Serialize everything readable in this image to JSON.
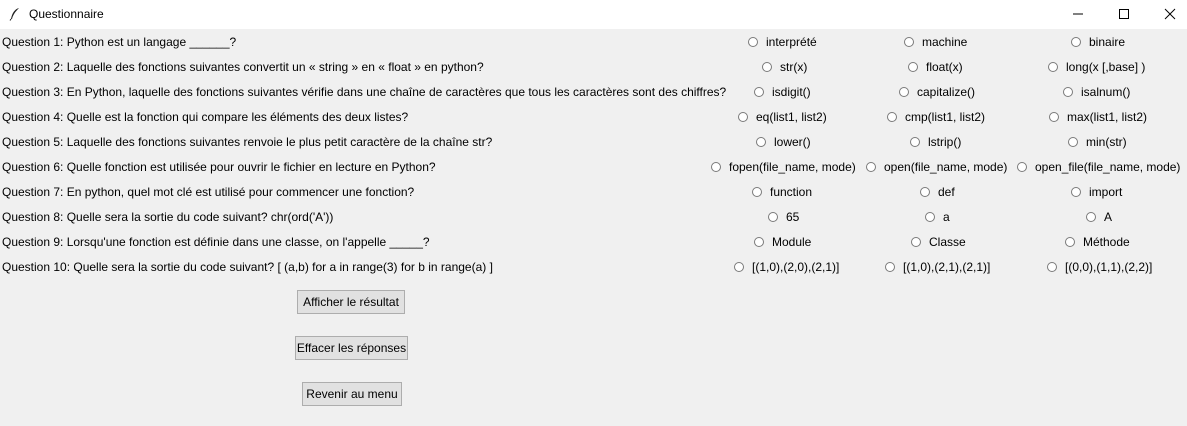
{
  "window": {
    "title": "Questionnaire",
    "app_icon": "feather-icon",
    "controls": [
      "minimize-icon",
      "maximize-icon",
      "close-icon"
    ]
  },
  "questions": [
    {
      "label": "Question 1: Python est un langage ______?",
      "options": [
        "interprété",
        "machine",
        "binaire"
      ]
    },
    {
      "label": "Question 2: Laquelle des fonctions suivantes convertit un « string » en « float » en python?",
      "options": [
        "str(x)",
        "float(x)",
        "long(x [,base] )"
      ]
    },
    {
      "label": "Question 3: En Python, laquelle des fonctions suivantes vérifie dans une chaîne de caractères que tous les caractères sont des chiffres?",
      "options": [
        "isdigit()",
        "capitalize()",
        "isalnum()"
      ]
    },
    {
      "label": "Question 4: Quelle est la fonction qui compare les éléments des deux listes?",
      "options": [
        "eq(list1, list2)",
        "cmp(list1, list2)",
        "max(list1, list2)"
      ]
    },
    {
      "label": "Question 5: Laquelle des fonctions suivantes renvoie le plus petit caractère de la chaîne str?",
      "options": [
        "lower()",
        "lstrip()",
        "min(str)"
      ]
    },
    {
      "label": "Question 6: Quelle fonction est utilisée pour ouvrir le fichier en lecture en Python?",
      "options": [
        "fopen(file_name, mode)",
        "open(file_name, mode)",
        "open_file(file_name, mode)"
      ]
    },
    {
      "label": "Question 7: En python, quel mot clé est utilisé pour commencer une fonction?",
      "options": [
        "function",
        "def",
        "import"
      ]
    },
    {
      "label": "Question 8: Quelle sera la sortie du code suivant? chr(ord('A'))",
      "options": [
        "65",
        "a",
        "A"
      ]
    },
    {
      "label": "Question 9: Lorsqu'une fonction est définie dans une classe, on l'appelle _____?",
      "options": [
        "Module",
        "Classe",
        "Méthode"
      ]
    },
    {
      "label": "Question 10: Quelle sera la sortie du code suivant? [ (a,b) for a in range(3) for b in range(a) ]",
      "options": [
        "[(1,0),(2,0),(2,1)]",
        "[(1,0),(2,1),(2,1)]",
        "[(0,0),(1,1),(2,2)]"
      ]
    }
  ],
  "buttons": {
    "show_result": "Afficher le résultat",
    "clear_answers": "Effacer les réponses",
    "back_to_menu": "Revenir au menu"
  }
}
